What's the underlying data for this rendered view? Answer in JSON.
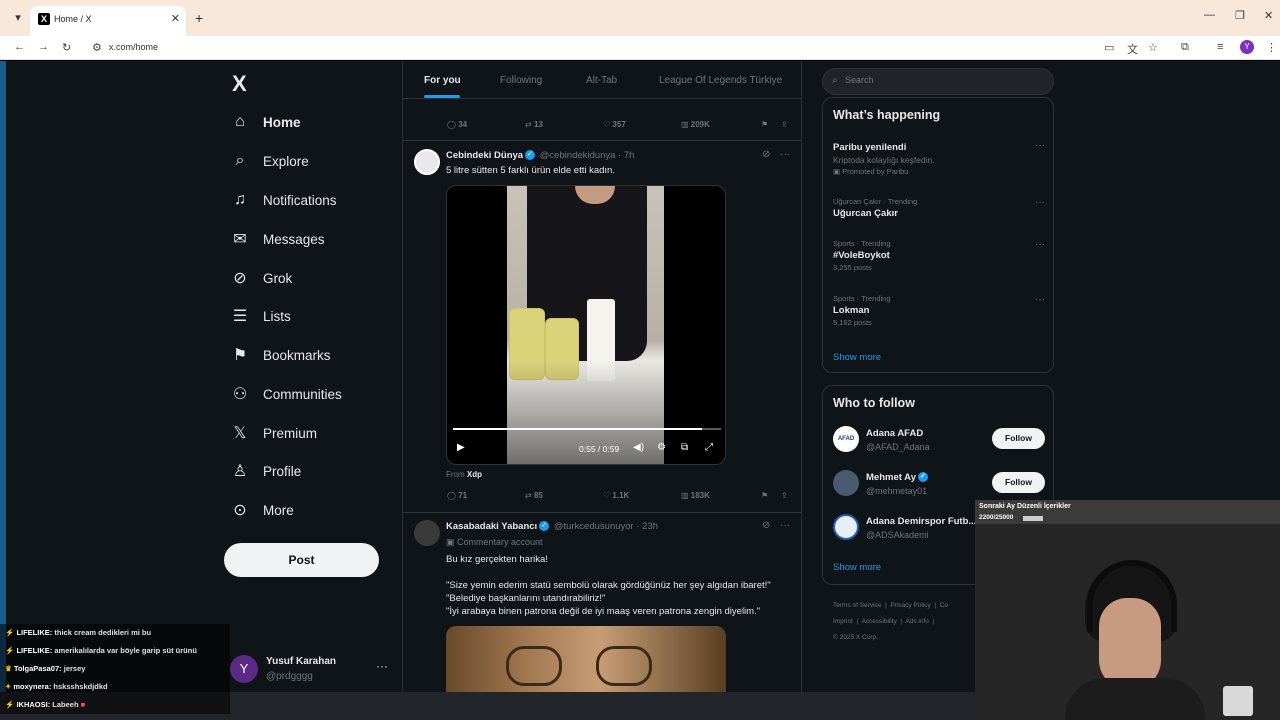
{
  "browser": {
    "tab_title": "Home / X",
    "tab_favicon": "X",
    "url": "x.com/home",
    "profile_initial": "Y"
  },
  "nav": {
    "logo": "X",
    "items": [
      {
        "label": "Home",
        "icon": "home-icon"
      },
      {
        "label": "Explore",
        "icon": "search-icon"
      },
      {
        "label": "Notifications",
        "icon": "bell-icon"
      },
      {
        "label": "Messages",
        "icon": "mail-icon"
      },
      {
        "label": "Grok",
        "icon": "grok-icon"
      },
      {
        "label": "Lists",
        "icon": "list-icon"
      },
      {
        "label": "Bookmarks",
        "icon": "bookmark-icon"
      },
      {
        "label": "Communities",
        "icon": "people-icon"
      },
      {
        "label": "Premium",
        "icon": "x-logo-icon"
      },
      {
        "label": "Profile",
        "icon": "user-icon"
      },
      {
        "label": "More",
        "icon": "more-circle-icon"
      }
    ],
    "post_label": "Post",
    "user": {
      "initial": "Y",
      "name": "Yusuf Karahan",
      "handle": "@prdgggg"
    }
  },
  "feed": {
    "tabs": [
      "For you",
      "Following",
      "Alt-Tab",
      "League Of Legends Türkiye"
    ],
    "top_actions": {
      "replies": "34",
      "reposts": "13",
      "likes": "357",
      "views": "209K"
    },
    "tweet1": {
      "name": "Cebindeki Dünya",
      "handle": "@cebindekidunya",
      "time": "· 7h",
      "text": "5 litre sütten 5 farklı ürün elde etti kadın.",
      "video_time": "0:55 / 0:59",
      "video_progress": 0.93,
      "from_label": "From",
      "from_source": "Xdp",
      "actions": {
        "replies": "71",
        "reposts": "85",
        "likes": "1.1K",
        "views": "183K"
      }
    },
    "tweet2": {
      "name": "Kasabadaki Yabancı",
      "handle": "@turkcedusunuyor",
      "time": "· 23h",
      "badge": "Commentary account",
      "lines": [
        "Bu kız gerçekten harika!",
        "",
        "\"Size yemin ederim statü sembolü olarak gördüğünüz her şey algıdan ibaret!\"",
        "\"Belediye başkanlarını utandırabiliriz!\"",
        "\"İyi arabaya binen patrona değil de iyi maaş veren patrona zengin diyelim.\""
      ]
    }
  },
  "search": {
    "placeholder": "Search"
  },
  "trends": {
    "title": "What’s happening",
    "items": [
      {
        "meta": "",
        "name": "Paribu yenilendi",
        "sub": "Kriptoda kolaylığı keşfedin.",
        "sub2": "Promoted by Paribu"
      },
      {
        "meta": "Uğurcan Çakır · Trending",
        "name": "Uğurcan Çakır",
        "sub": ""
      },
      {
        "meta": "Sports · Trending",
        "name": "#VoleBoykot",
        "sub": "3,255 posts"
      },
      {
        "meta": "Sports · Trending",
        "name": "Lokman",
        "sub": "5,162 posts"
      }
    ],
    "show_more": "Show more"
  },
  "who_to_follow": {
    "title": "Who to follow",
    "items": [
      {
        "name": "Adana AFAD",
        "handle": "@AFAD_Adana",
        "follow": "Follow",
        "avatar_text": "AFAD"
      },
      {
        "name": "Mehmet Ay",
        "handle": "@mehmetay01",
        "follow": "Follow"
      },
      {
        "name": "Adana Demirspor Futb...",
        "handle": "@ADSAkademi",
        "follow": "Follow"
      }
    ],
    "show_more": "Show more"
  },
  "footer": {
    "links": [
      "Terms of Service",
      "Privacy Policy",
      "Co",
      "Imprint",
      "Accessibility",
      "Ads info"
    ],
    "copyright": "© 2025 X Corp."
  },
  "chat": [
    {
      "user": "LIFELIKE:",
      "msg": "thick cream dedikleri mi bu"
    },
    {
      "user": "LIFELIKE:",
      "msg": "amerikalılarda var böyle garip süt ürünü"
    },
    {
      "user": "TolgaPasa07:",
      "msg": "jersey"
    },
    {
      "user": "moxynera:",
      "msg": "hsksshskdjdkd"
    },
    {
      "user": "IKHAOSI:",
      "msg": "Labeeh"
    }
  ],
  "overlay": {
    "title": "Sonraki Ay Düzenli İçerikler",
    "count": "2200/25000"
  },
  "colors": {
    "accent": "#1d9bf0",
    "background": "#0f1418",
    "border": "#2f3336",
    "text": "#e7e9ea",
    "muted": "#71767b"
  }
}
